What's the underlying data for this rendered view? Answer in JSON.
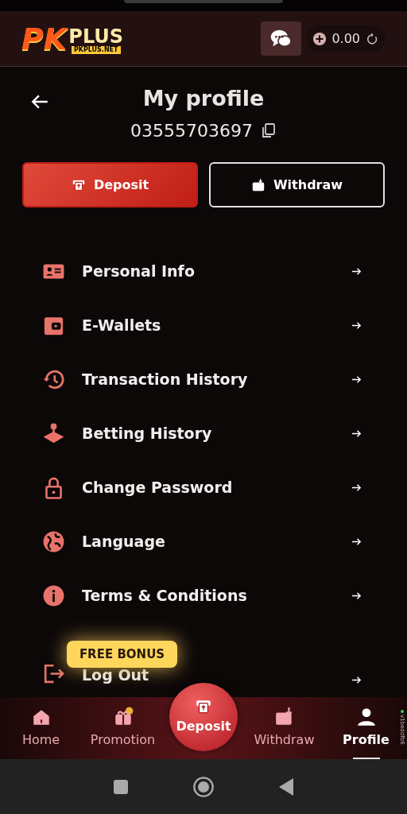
{
  "header": {
    "logo_main": "PK",
    "logo_plus": "PLUS",
    "logo_site": "PKPLUS.NET",
    "balance": "0.00"
  },
  "page": {
    "title": "My profile",
    "phone": "03555703697"
  },
  "actions": [
    {
      "label": "Deposit",
      "kind": "deposit"
    },
    {
      "label": "Withdraw",
      "kind": "withdraw"
    }
  ],
  "menu": [
    {
      "label": "Personal Info",
      "kind": "id"
    },
    {
      "label": "E-Wallets",
      "kind": "wallet"
    },
    {
      "label": "Transaction History",
      "kind": "history"
    },
    {
      "label": "Betting History",
      "kind": "joystick"
    },
    {
      "label": "Change Password",
      "kind": "lock"
    },
    {
      "label": "Language",
      "kind": "globe"
    },
    {
      "label": "Terms & Conditions",
      "kind": "info"
    },
    {
      "label": "Log Out",
      "kind": "logout"
    }
  ],
  "promo_badge": "FREE BONUS",
  "bottom_nav": [
    {
      "label": "Home",
      "kind": "home",
      "selected": false
    },
    {
      "label": "Promotion",
      "kind": "gift",
      "selected": false
    },
    {
      "label": "Deposit",
      "kind": "deposit",
      "selected": false
    },
    {
      "label": "Withdraw",
      "kind": "withdraw",
      "selected": false
    },
    {
      "label": "Profile",
      "kind": "profile",
      "selected": true
    }
  ],
  "version": "v1beddfb6"
}
